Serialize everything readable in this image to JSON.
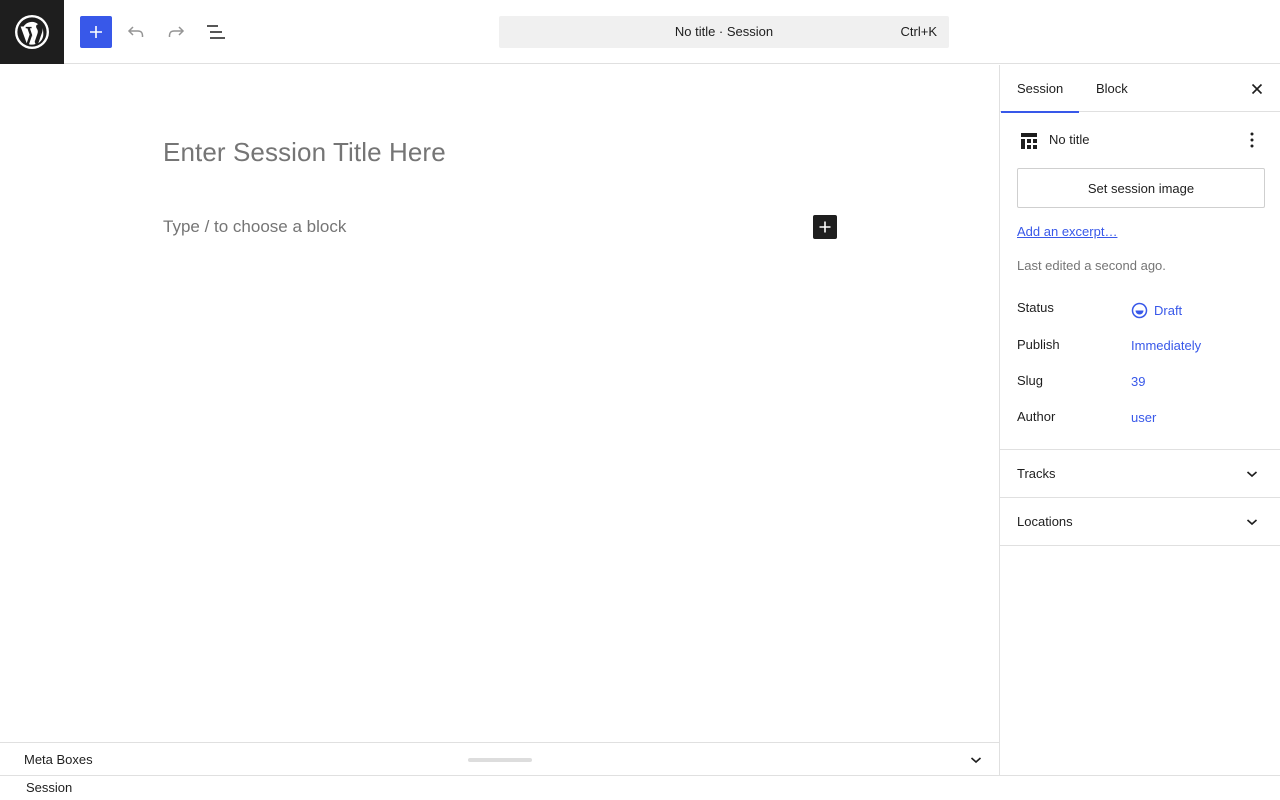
{
  "header": {
    "document_title": "No title · Session",
    "shortcut": "Ctrl+K",
    "icons": {
      "logo": "wordpress-icon",
      "add": "plus-icon",
      "undo": "undo-icon",
      "redo": "redo-icon",
      "list_view": "list-view-icon"
    }
  },
  "editor": {
    "title_placeholder": "Enter Session Title Here",
    "block_placeholder": "Type / to choose a block"
  },
  "meta_boxes": {
    "label": "Meta Boxes"
  },
  "footer": {
    "breadcrumb": "Session"
  },
  "sidebar": {
    "tabs": [
      {
        "label": "Session",
        "active": true
      },
      {
        "label": "Block",
        "active": false
      }
    ],
    "post_title": "No title",
    "set_image_label": "Set session image",
    "excerpt_link": "Add an excerpt…",
    "last_edited": "Last edited a second ago.",
    "properties": {
      "status": {
        "label": "Status",
        "value": "Draft"
      },
      "publish": {
        "label": "Publish",
        "value": "Immediately"
      },
      "slug": {
        "label": "Slug",
        "value": "39"
      },
      "author": {
        "label": "Author",
        "value": "user"
      }
    },
    "panels": [
      {
        "label": "Tracks",
        "expanded": false
      },
      {
        "label": "Locations",
        "expanded": false
      }
    ]
  },
  "colors": {
    "accent": "#3858e9",
    "dark": "#1e1e1e",
    "muted": "#757575",
    "border": "#e0e0e0"
  }
}
